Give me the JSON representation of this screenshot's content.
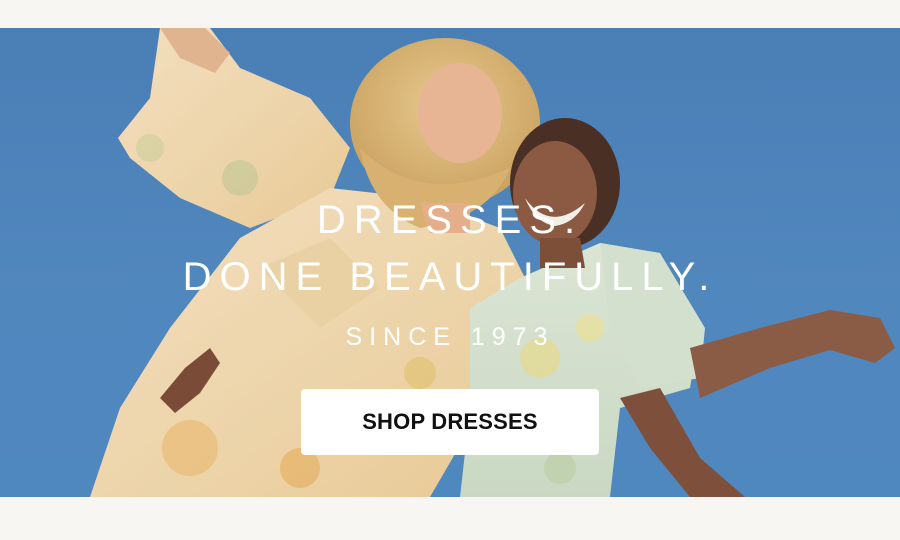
{
  "hero": {
    "headline_line1": "DRESSES.",
    "headline_line2": "DONE BEAUTIFULLY.",
    "tagline": "SINCE 1973",
    "cta_label": "SHOP DRESSES",
    "image_alt": ""
  },
  "colors": {
    "sky": "#4f87bf",
    "page_background": "#f8f6f3",
    "text": "#ffffff",
    "button_background": "#ffffff",
    "button_text": "#111111"
  }
}
